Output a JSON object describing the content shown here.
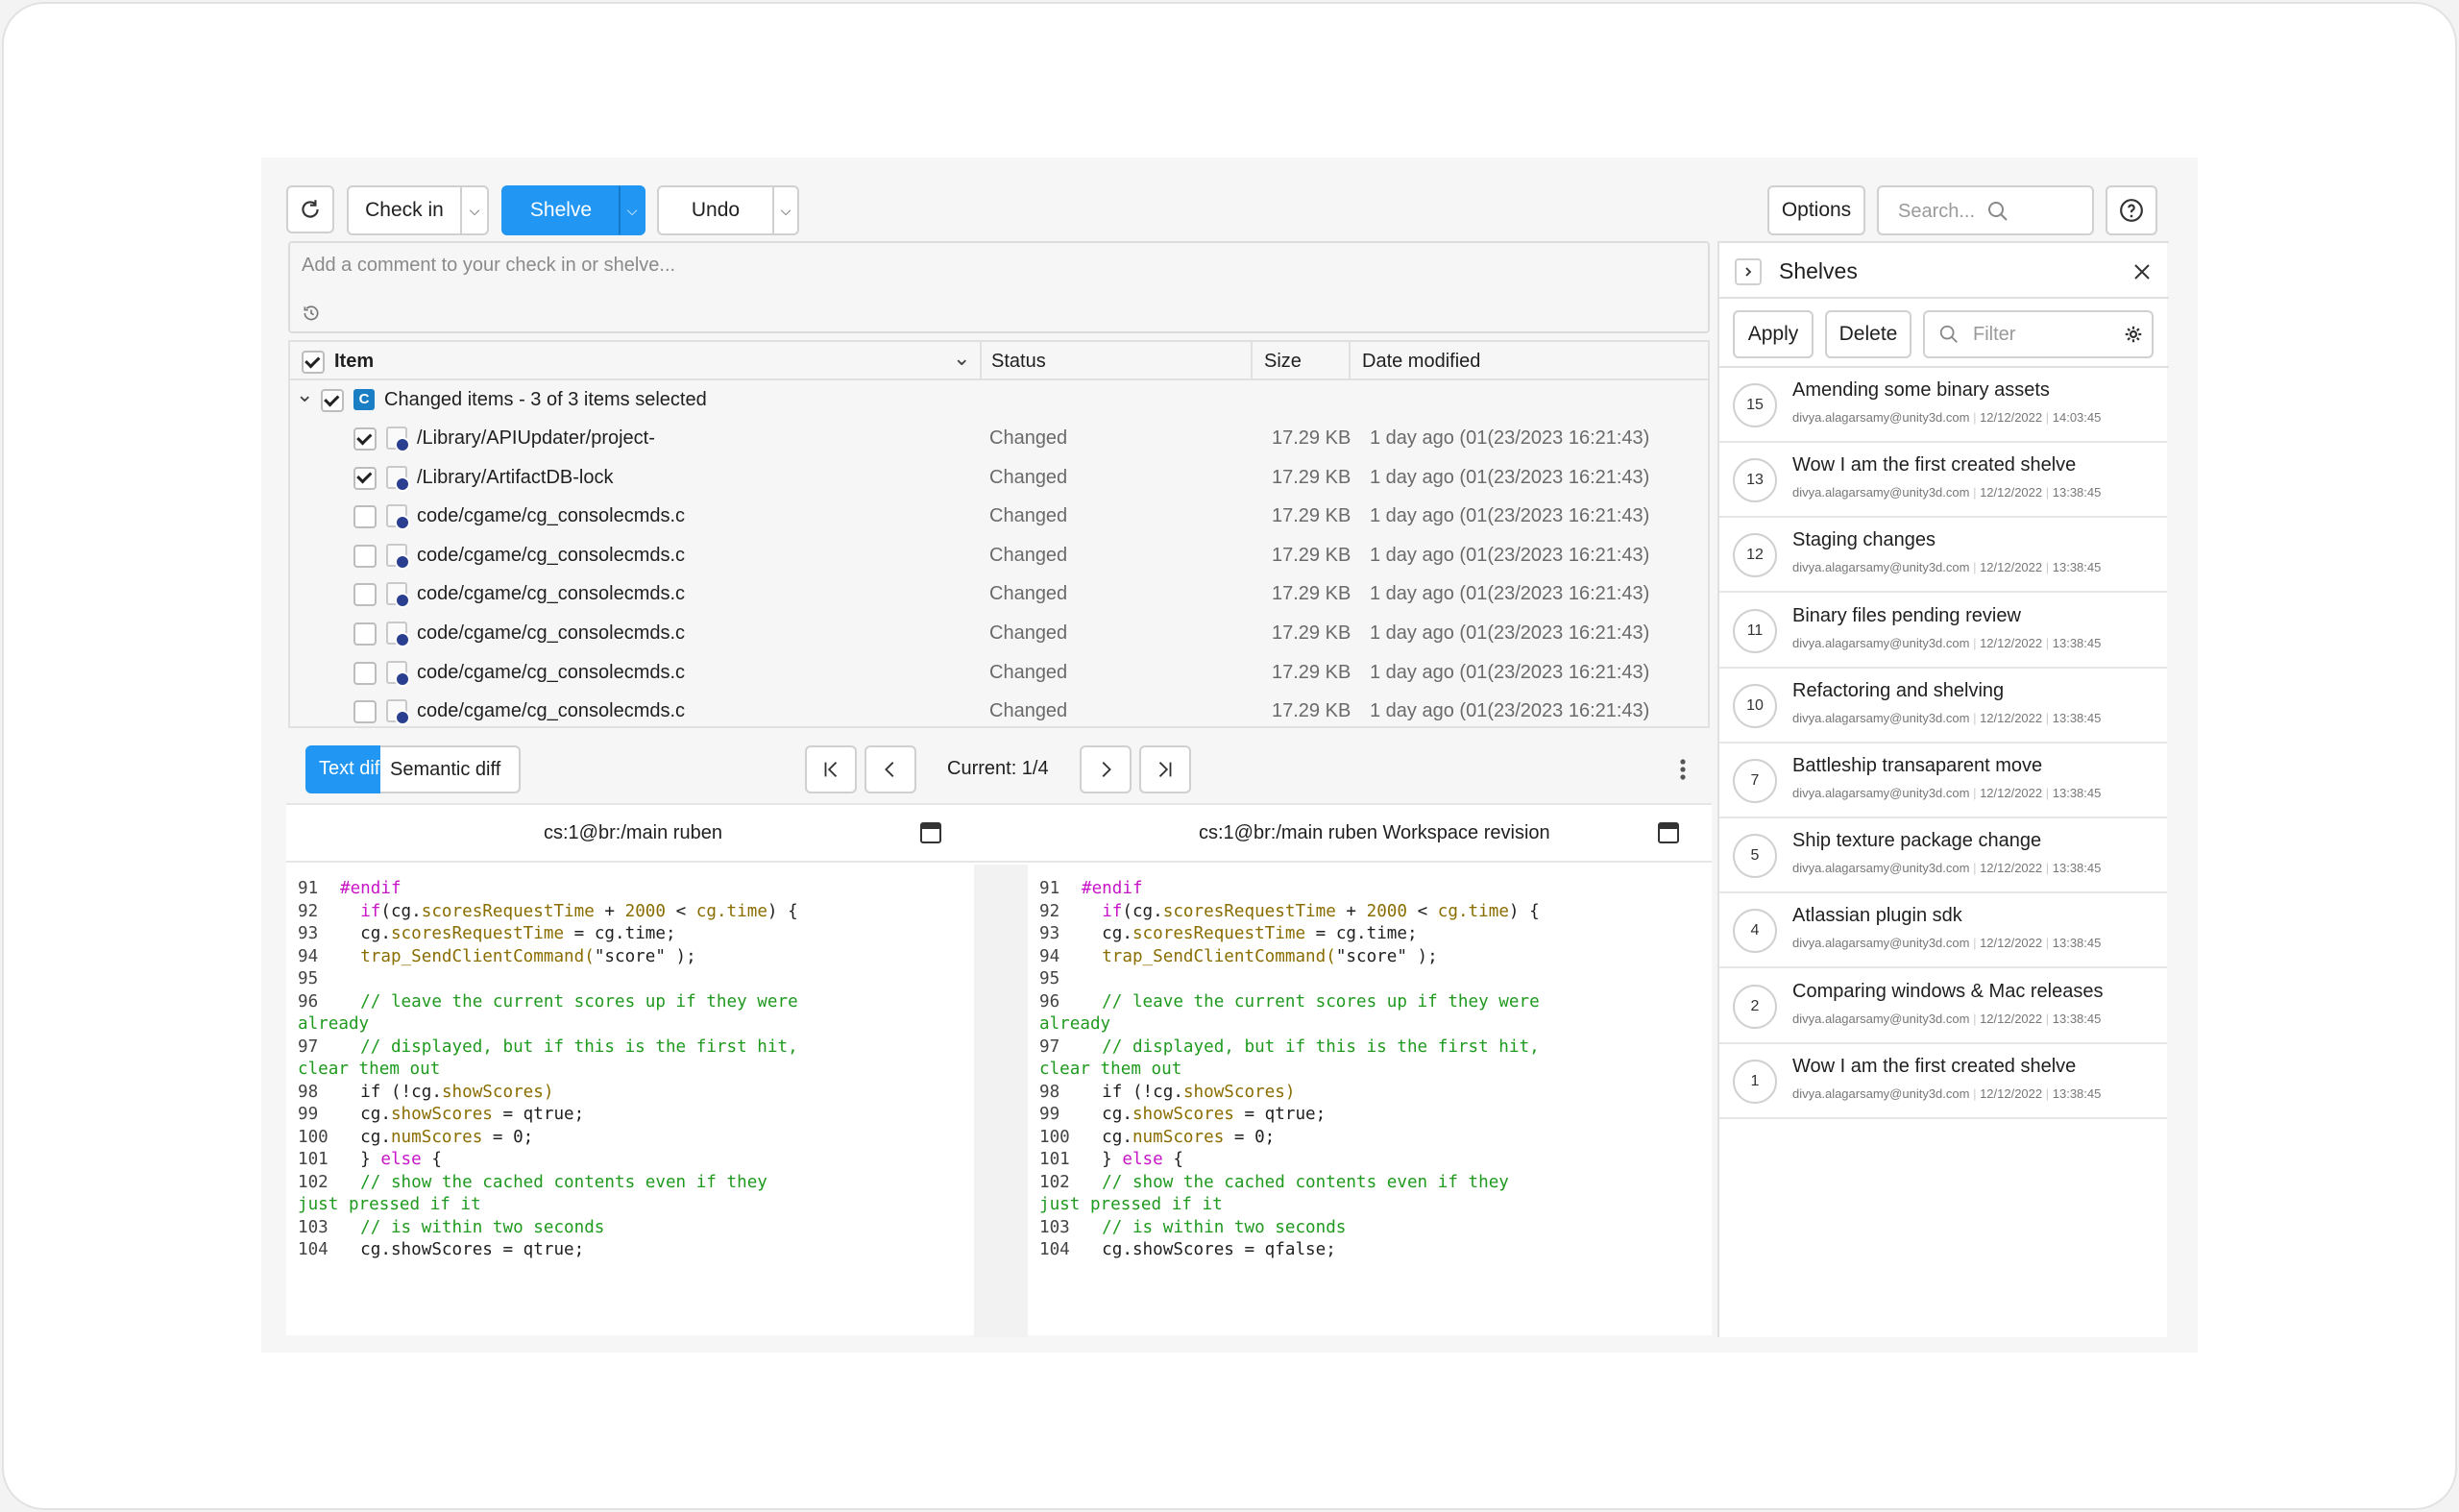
{
  "toolbar": {
    "check_in": "Check in",
    "shelve": "Shelve",
    "undo": "Undo",
    "options": "Options",
    "search_placeholder": "Search..."
  },
  "comment": {
    "placeholder": "Add a comment to your check in or shelve..."
  },
  "table": {
    "headers": {
      "item": "Item",
      "status": "Status",
      "size": "Size",
      "date": "Date modified"
    },
    "group": {
      "badge": "C",
      "label": "Changed items - 3 of 3 items selected"
    },
    "rows": [
      {
        "name": "/Library/APIUpdater/project-",
        "status": "Changed",
        "size": "17.29 KB",
        "date": "1 day ago (01(23/2023 16:21:43)",
        "checked": true
      },
      {
        "name": "/Library/ArtifactDB-lock",
        "status": "Changed",
        "size": "17.29 KB",
        "date": "1 day ago (01(23/2023 16:21:43)",
        "checked": true
      },
      {
        "name": "code/cgame/cg_consolecmds.c",
        "status": "Changed",
        "size": "17.29 KB",
        "date": "1 day ago (01(23/2023 16:21:43)",
        "checked": false
      },
      {
        "name": "code/cgame/cg_consolecmds.c",
        "status": "Changed",
        "size": "17.29 KB",
        "date": "1 day ago (01(23/2023 16:21:43)",
        "checked": false
      },
      {
        "name": "code/cgame/cg_consolecmds.c",
        "status": "Changed",
        "size": "17.29 KB",
        "date": "1 day ago (01(23/2023 16:21:43)",
        "checked": false
      },
      {
        "name": "code/cgame/cg_consolecmds.c",
        "status": "Changed",
        "size": "17.29 KB",
        "date": "1 day ago (01(23/2023 16:21:43)",
        "checked": false
      },
      {
        "name": "code/cgame/cg_consolecmds.c",
        "status": "Changed",
        "size": "17.29 KB",
        "date": "1 day ago (01(23/2023 16:21:43)",
        "checked": false
      },
      {
        "name": "code/cgame/cg_consolecmds.c",
        "status": "Changed",
        "size": "17.29 KB",
        "date": "1 day ago (01(23/2023 16:21:43)",
        "checked": false
      }
    ]
  },
  "diff": {
    "tab_text": "Text dif",
    "tab_semantic": "Semantic diff",
    "current": "Current: 1/4",
    "left_title": "cs:1@br:/main ruben",
    "right_title": "cs:1@br:/main ruben Workspace revision",
    "left_code": [
      [
        "91",
        [
          [
            "k",
            "#endif"
          ]
        ]
      ],
      [
        "92",
        [
          [
            "p",
            "  "
          ],
          [
            "k",
            "if"
          ],
          [
            "p",
            "(cg."
          ],
          [
            "m",
            "scoresRequestTime"
          ],
          [
            "p",
            " + "
          ],
          [
            "n",
            "2000"
          ],
          [
            "p",
            " < "
          ],
          [
            "m",
            "cg.time"
          ],
          [
            "p",
            ") {"
          ]
        ]
      ],
      [
        "93",
        [
          [
            "p",
            "  cg."
          ],
          [
            "m",
            "scoresRequestTime"
          ],
          [
            "p",
            " = cg.time;"
          ]
        ]
      ],
      [
        "94",
        [
          [
            "p",
            "  "
          ],
          [
            "m",
            "trap_SendClientCommand("
          ],
          [
            "p",
            "\"score\" );"
          ]
        ]
      ],
      [
        "95",
        []
      ],
      [
        "96",
        [
          [
            "c",
            "  // leave the current scores up if they were"
          ]
        ]
      ],
      [
        "",
        [
          [
            "c",
            "already"
          ]
        ]
      ],
      [
        "97",
        [
          [
            "c",
            "  // displayed, but if this is the first hit,"
          ]
        ]
      ],
      [
        "",
        [
          [
            "c",
            "clear them out"
          ]
        ]
      ],
      [
        "98",
        [
          [
            "p",
            "  if (!cg."
          ],
          [
            "m",
            "showScores)"
          ]
        ]
      ],
      [
        "99",
        [
          [
            "p",
            "  cg."
          ],
          [
            "m",
            "showScores"
          ],
          [
            "p",
            " = qtrue;"
          ]
        ]
      ],
      [
        "100",
        [
          [
            "p",
            "  cg."
          ],
          [
            "m",
            "numScores"
          ],
          [
            "p",
            " = 0;"
          ]
        ]
      ],
      [
        "101",
        [
          [
            "p",
            "  } "
          ],
          [
            "k",
            "else"
          ],
          [
            "p",
            " {"
          ]
        ]
      ],
      [
        "102",
        [
          [
            "c",
            "  // show the cached contents even if they"
          ]
        ]
      ],
      [
        "",
        [
          [
            "c",
            "just pressed if it"
          ]
        ]
      ],
      [
        "103",
        [
          [
            "c",
            "  // is within two seconds"
          ]
        ]
      ],
      [
        "104",
        [
          [
            "p",
            "  cg.showScores = qtrue;"
          ]
        ]
      ]
    ],
    "right_code": [
      [
        "91",
        [
          [
            "k",
            "#endif"
          ]
        ]
      ],
      [
        "92",
        [
          [
            "p",
            "  "
          ],
          [
            "k",
            "if"
          ],
          [
            "p",
            "(cg."
          ],
          [
            "m",
            "scoresRequestTime"
          ],
          [
            "p",
            " + "
          ],
          [
            "n",
            "2000"
          ],
          [
            "p",
            " < "
          ],
          [
            "m",
            "cg.time"
          ],
          [
            "p",
            ") {"
          ]
        ]
      ],
      [
        "93",
        [
          [
            "p",
            "  cg."
          ],
          [
            "m",
            "scoresRequestTime"
          ],
          [
            "p",
            " = cg.time;"
          ]
        ]
      ],
      [
        "94",
        [
          [
            "p",
            "  "
          ],
          [
            "m",
            "trap_SendClientCommand("
          ],
          [
            "p",
            "\"score\" );"
          ]
        ]
      ],
      [
        "95",
        []
      ],
      [
        "96",
        [
          [
            "c",
            "  // leave the current scores up if they were"
          ]
        ]
      ],
      [
        "",
        [
          [
            "c",
            "already"
          ]
        ]
      ],
      [
        "97",
        [
          [
            "c",
            "  // displayed, but if this is the first hit,"
          ]
        ]
      ],
      [
        "",
        [
          [
            "c",
            "clear them out"
          ]
        ]
      ],
      [
        "98",
        [
          [
            "p",
            "  if (!cg."
          ],
          [
            "m",
            "showScores)"
          ]
        ]
      ],
      [
        "99",
        [
          [
            "p",
            "  cg."
          ],
          [
            "m",
            "showScores"
          ],
          [
            "p",
            " = qtrue;"
          ]
        ]
      ],
      [
        "100",
        [
          [
            "p",
            "  cg."
          ],
          [
            "m",
            "numScores"
          ],
          [
            "p",
            " = 0;"
          ]
        ]
      ],
      [
        "101",
        [
          [
            "p",
            "  } "
          ],
          [
            "k",
            "else"
          ],
          [
            "p",
            " {"
          ]
        ]
      ],
      [
        "102",
        [
          [
            "c",
            "  // show the cached contents even if they"
          ]
        ]
      ],
      [
        "",
        [
          [
            "c",
            "just pressed if it"
          ]
        ]
      ],
      [
        "103",
        [
          [
            "c",
            "  // is within two seconds"
          ]
        ]
      ],
      [
        "104",
        [
          [
            "p",
            "  cg.showScores = qfalse;"
          ]
        ]
      ]
    ]
  },
  "shelves": {
    "title": "Shelves",
    "apply": "Apply",
    "delete": "Delete",
    "filter_placeholder": "Filter",
    "items": [
      {
        "num": "15",
        "title": "Amending some binary assets",
        "email": "divya.alagarsamy@unity3d.com",
        "date": "12/12/2022",
        "time": "14:03:45"
      },
      {
        "num": "13",
        "title": "Wow I am the first created shelve",
        "email": "divya.alagarsamy@unity3d.com",
        "date": "12/12/2022",
        "time": "13:38:45"
      },
      {
        "num": "12",
        "title": "Staging changes",
        "email": "divya.alagarsamy@unity3d.com",
        "date": "12/12/2022",
        "time": "13:38:45"
      },
      {
        "num": "11",
        "title": "Binary files pending review",
        "email": "divya.alagarsamy@unity3d.com",
        "date": "12/12/2022",
        "time": "13:38:45"
      },
      {
        "num": "10",
        "title": "Refactoring and shelving",
        "email": "divya.alagarsamy@unity3d.com",
        "date": "12/12/2022",
        "time": "13:38:45"
      },
      {
        "num": "7",
        "title": "Battleship transaparent move",
        "email": "divya.alagarsamy@unity3d.com",
        "date": "12/12/2022",
        "time": "13:38:45"
      },
      {
        "num": "5",
        "title": "Ship texture package change",
        "email": "divya.alagarsamy@unity3d.com",
        "date": "12/12/2022",
        "time": "13:38:45"
      },
      {
        "num": "4",
        "title": "Atlassian plugin sdk",
        "email": "divya.alagarsamy@unity3d.com",
        "date": "12/12/2022",
        "time": "13:38:45"
      },
      {
        "num": "2",
        "title": "Comparing windows & Mac releases",
        "email": "divya.alagarsamy@unity3d.com",
        "date": "12/12/2022",
        "time": "13:38:45"
      },
      {
        "num": "1",
        "title": "Wow I am the first created shelve",
        "email": "divya.alagarsamy@unity3d.com",
        "date": "12/12/2022",
        "time": "13:38:45"
      }
    ]
  },
  "colors": {
    "accent": "#2196f3",
    "keyword": "#c815c8",
    "member": "#8a6d00",
    "comment": "#1f9a1f",
    "badge": "#1a7ec4"
  }
}
